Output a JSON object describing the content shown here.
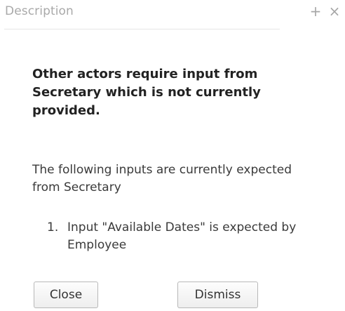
{
  "panel": {
    "title": "Description",
    "add_icon": "plus-icon",
    "close_icon": "close-icon",
    "add_glyph": "+",
    "close_glyph": "×"
  },
  "message": {
    "headline": "Other actors require input from Secretary which is not currently provided.",
    "intro": "The following inputs are currently expected from Secretary",
    "items": [
      {
        "number": "1.",
        "text": "Input \"Available Dates\" is expected by Employee"
      }
    ]
  },
  "buttons": {
    "close_label": "Close",
    "dismiss_label": "Dismiss"
  },
  "colors": {
    "title": "#a9a9a9",
    "icon": "#a7a7a7",
    "text": "#333333"
  }
}
